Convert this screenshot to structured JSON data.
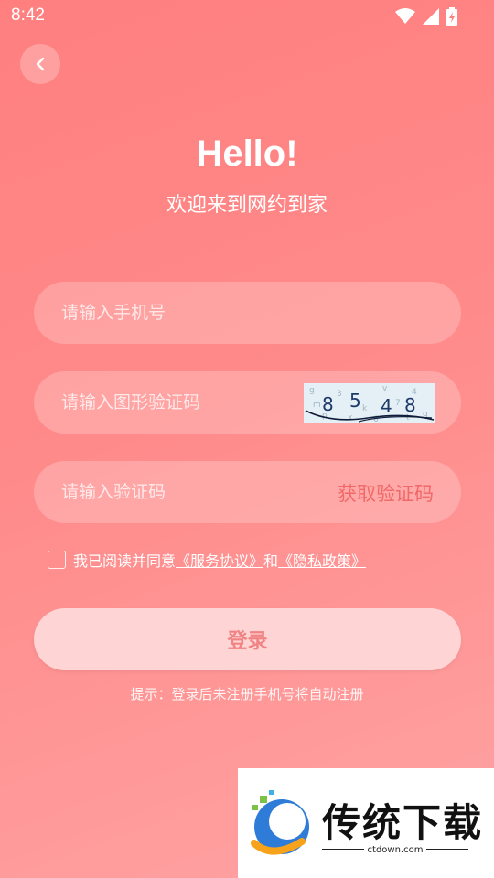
{
  "status_bar": {
    "time": "8:42"
  },
  "header": {
    "title": "Hello!",
    "subtitle": "欢迎来到网约到家"
  },
  "form": {
    "phone_placeholder": "请输入手机号",
    "captcha_placeholder": "请输入图形验证码",
    "captcha_code": [
      "8",
      "5",
      "4",
      "8"
    ],
    "sms_placeholder": "请输入验证码",
    "get_code_label": "获取验证码"
  },
  "agreement": {
    "prefix": "我已阅读并同意",
    "service_link": "《服务协议》",
    "and": "和",
    "privacy_link": "《隐私政策》",
    "checked": false
  },
  "login_label": "登录",
  "tip": "提示：登录后未注册手机号将自动注册",
  "watermark": {
    "name": "传统下载",
    "url": "ctdown.com"
  },
  "colors": {
    "accent": "#ff7f7f",
    "button_bg": "#ffd4d4",
    "get_code": "#f06868"
  }
}
